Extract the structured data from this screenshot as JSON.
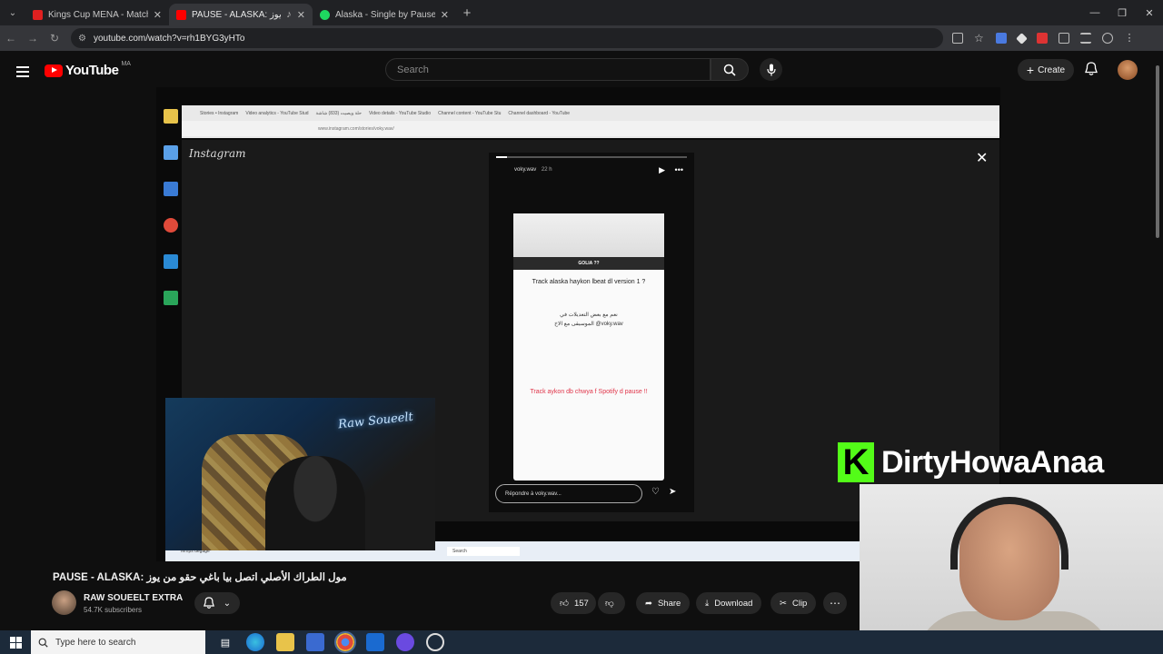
{
  "browser": {
    "tabs": [
      {
        "title": "Kings Cup MENA - Matchda",
        "fav_color": "#e02020",
        "active": false
      },
      {
        "title": "PAUSE - ALASKA: ﺣﻘﻮ ﻣﻦ ﻳﻮﺯ",
        "fav_color": "#ff0000",
        "active": true
      },
      {
        "title": "Alaska - Single by Pause | Spoti",
        "fav_color": "#1ed760",
        "active": false
      }
    ],
    "url": "youtube.com/watch?v=rh1BYG3yHTo"
  },
  "youtube": {
    "logo_text": "YouTube",
    "country_code": "MA",
    "search_placeholder": "Search",
    "create_label": "Create"
  },
  "video": {
    "inner_tabs": [
      "Stories • Instagram",
      "Video analytics - YouTube Stud",
      "ﺣﻠﺔ ﻭﻳﺼﻴﺖ (833) ﺷﺎﺷﺔ",
      "Video details - YouTube Studio",
      "Channel content - YouTube Stu",
      "Channel dashboard - YouTube"
    ],
    "inner_url": "www.instagram.com/stories/voky.wav/",
    "ig_logo": "Instagram",
    "story_user": "voky.wav",
    "story_time": "22 h",
    "question_tag": "GOLIA ??",
    "question": "Track alaska haykon lbeat dl version 1 ?",
    "arabic_line1": "ﻧﻌﻢ ﻣﻊ ﺑﻌﺾ ﺍﻟﺘﻌﺪﻳﻼﺕ ﻓﻲ",
    "arabic_line2": "ﺍﻟﻤﻮﺳﻴﻘﻰ ﻣﻊ ﺍﻻﺥ @voky.wav",
    "red_text": "Track aykon db chwya f Spotify d pause !!",
    "reply_placeholder": "Répondre à voky.wav...",
    "inner_search": "Search",
    "inner_temps": "Temps dégagé",
    "webcam_sign": "Raw Soueelt"
  },
  "overlay": {
    "kick_letter": "K",
    "kick_name": "DirtyHowaAnaa"
  },
  "watch": {
    "title": "PAUSE - ALASKA: مول الطراك الأصلي اتصل بيا باغي حقو من يوز",
    "channel": "RAW SOUEELT EXTRA",
    "subscribers": "54.7K subscribers",
    "likes": "157",
    "share": "Share",
    "download": "Download",
    "clip": "Clip"
  },
  "taskbar": {
    "search_placeholder": "Type here to search"
  }
}
